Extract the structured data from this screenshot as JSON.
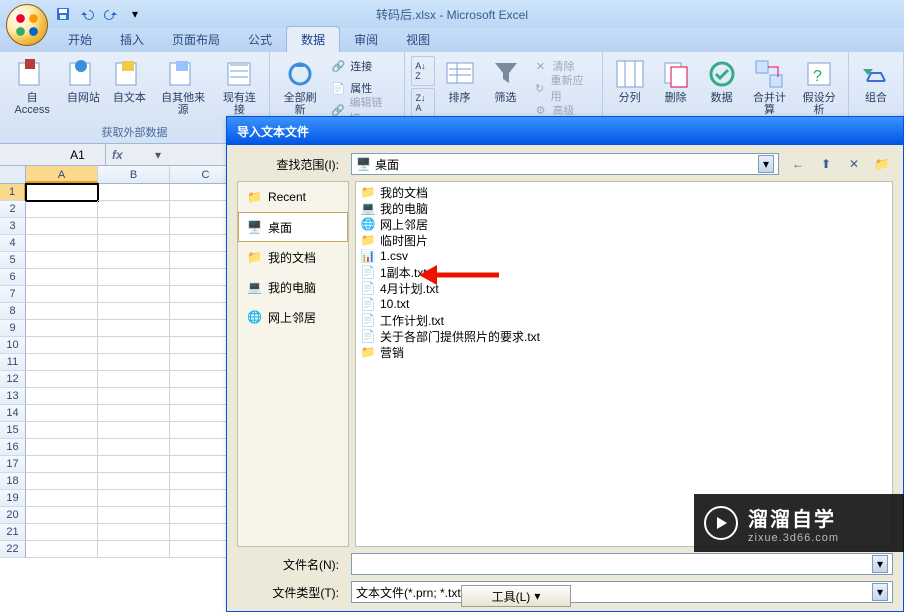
{
  "app_title": "转码后.xlsx - Microsoft Excel",
  "ribbon_tabs": [
    "开始",
    "插入",
    "页面布局",
    "公式",
    "数据",
    "审阅",
    "视图"
  ],
  "ribbon_active_tab_index": 4,
  "ribbon": {
    "group1_label": "获取外部数据",
    "btn_access": "自 Access",
    "btn_web": "自网站",
    "btn_text": "自文本",
    "btn_other": "自其他来源",
    "btn_existing": "现有连接",
    "group2_label": "",
    "btn_refresh": "全部刷新",
    "conn": "连接",
    "prop": "属性",
    "editlink": "编辑链接",
    "sort_az": "A↓Z",
    "sort_za": "Z↓A",
    "btn_sort": "排序",
    "btn_filter": "筛选",
    "clear": "清除",
    "reapply": "重新应用",
    "advanced": "高级",
    "btn_t2c": "分列",
    "btn_dedup": "删除",
    "btn_dv": "数据",
    "btn_consol": "合并计算",
    "btn_whatif": "假设分析",
    "btn_group": "组合"
  },
  "name_box_value": "A1",
  "columns": [
    "A",
    "B",
    "C"
  ],
  "row_count": 22,
  "active_cell": {
    "col": 0,
    "row": 0
  },
  "dialog": {
    "title": "导入文本文件",
    "lookin_label": "查找范围(I):",
    "lookin_value": "桌面",
    "places": [
      {
        "icon": "recent",
        "label": "Recent"
      },
      {
        "icon": "desktop",
        "label": "桌面"
      },
      {
        "icon": "mydocs",
        "label": "我的文档"
      },
      {
        "icon": "mycomputer",
        "label": "我的电脑"
      },
      {
        "icon": "network",
        "label": "网上邻居"
      }
    ],
    "places_selected_index": 1,
    "files": [
      {
        "icon": "folder",
        "name": "我的文档"
      },
      {
        "icon": "mycomputer",
        "name": "我的电脑"
      },
      {
        "icon": "network",
        "name": "网上邻居"
      },
      {
        "icon": "folder",
        "name": "临时图片"
      },
      {
        "icon": "csv",
        "name": "1.csv"
      },
      {
        "icon": "txt",
        "name": "1副本.txt"
      },
      {
        "icon": "txt",
        "name": "4月计划.txt"
      },
      {
        "icon": "txt",
        "name": "10.txt"
      },
      {
        "icon": "txt",
        "name": "工作计划.txt"
      },
      {
        "icon": "txt",
        "name": "关于各部门提供照片的要求.txt"
      },
      {
        "icon": "folder",
        "name": "营销"
      }
    ],
    "filename_label": "文件名(N):",
    "filename_value": "",
    "filetype_label": "文件类型(T):",
    "filetype_value": "文本文件(*.prn; *.txt; *.csv)",
    "tools_label": "工具(L)"
  },
  "watermark": {
    "cn": "溜溜自学",
    "url": "zixue.3d66.com"
  },
  "colors": {
    "accent": "#0054e3"
  }
}
